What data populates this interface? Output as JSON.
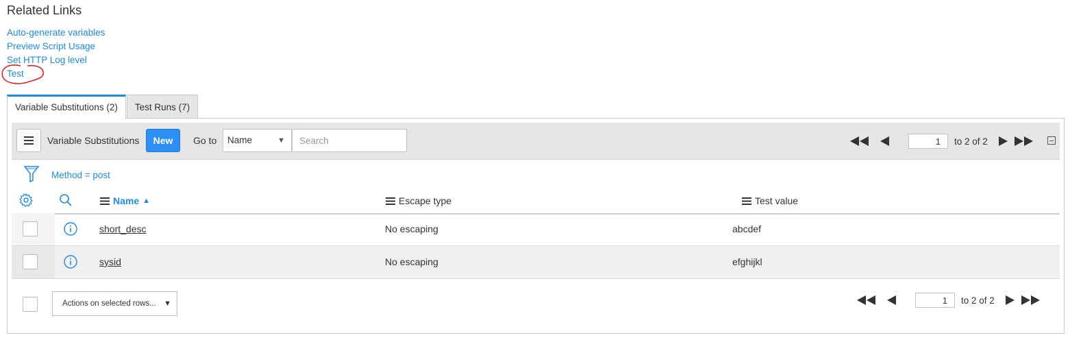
{
  "related": {
    "title": "Related Links",
    "links": [
      "Auto-generate variables",
      "Preview Script Usage",
      "Set HTTP Log level",
      "Test"
    ]
  },
  "tabs": [
    {
      "label": "Variable Substitutions (2)",
      "active": true
    },
    {
      "label": "Test Runs (7)",
      "active": false
    }
  ],
  "list": {
    "title": "Variable Substitutions",
    "new_label": "New",
    "goto_label": "Go to",
    "goto_value": "Name",
    "search_placeholder": "Search",
    "page": "1",
    "page_of": "to 2 of 2",
    "filter": "Method = post",
    "columns": [
      "Name",
      "Escape type",
      "Test value"
    ],
    "sort_indicator": "▲",
    "rows": [
      {
        "name": "short_desc",
        "escape": "No escaping",
        "value": "abcdef"
      },
      {
        "name": "sysid",
        "escape": "No escaping",
        "value": "efghijkl"
      }
    ],
    "actions_label": "Actions on selected rows..."
  },
  "colors": {
    "accent": "#1f8ae1",
    "button": "#2d8ef3",
    "annotation": "#e02020"
  }
}
